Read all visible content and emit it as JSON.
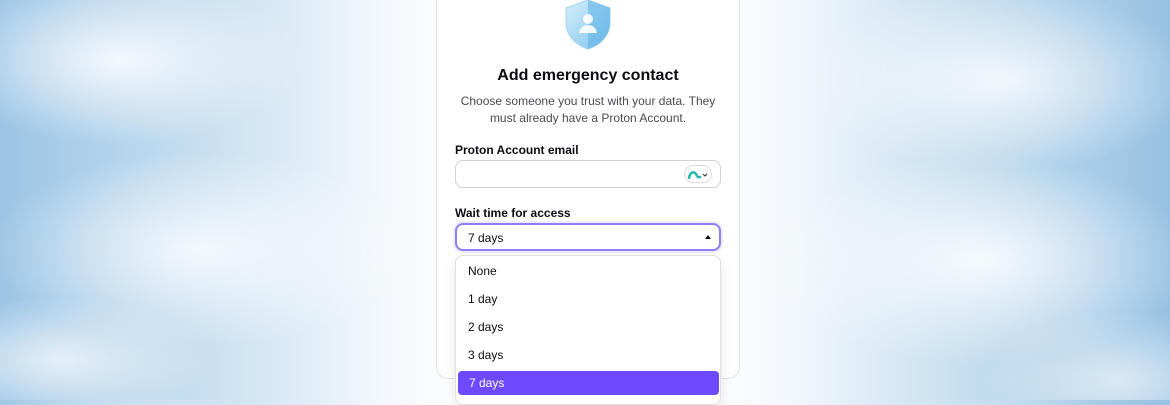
{
  "dialog": {
    "title": "Add emergency contact",
    "subtitle": "Choose someone you trust with your data. They must already have a Proton Account."
  },
  "email_field": {
    "label": "Proton Account email",
    "value": "",
    "placeholder": "",
    "icon": "proton-logo-icon"
  },
  "wait_time": {
    "label": "Wait time for access",
    "selected": "7 days",
    "options": [
      "None",
      "1 day",
      "2 days",
      "3 days",
      "7 days"
    ]
  },
  "colors": {
    "accent": "#6d4aff",
    "focus_border": "#8b7ff6",
    "shield_light": "#c6e6f6",
    "shield_dark": "#5fb3e6",
    "proton_logo": "#1fb8a8"
  }
}
